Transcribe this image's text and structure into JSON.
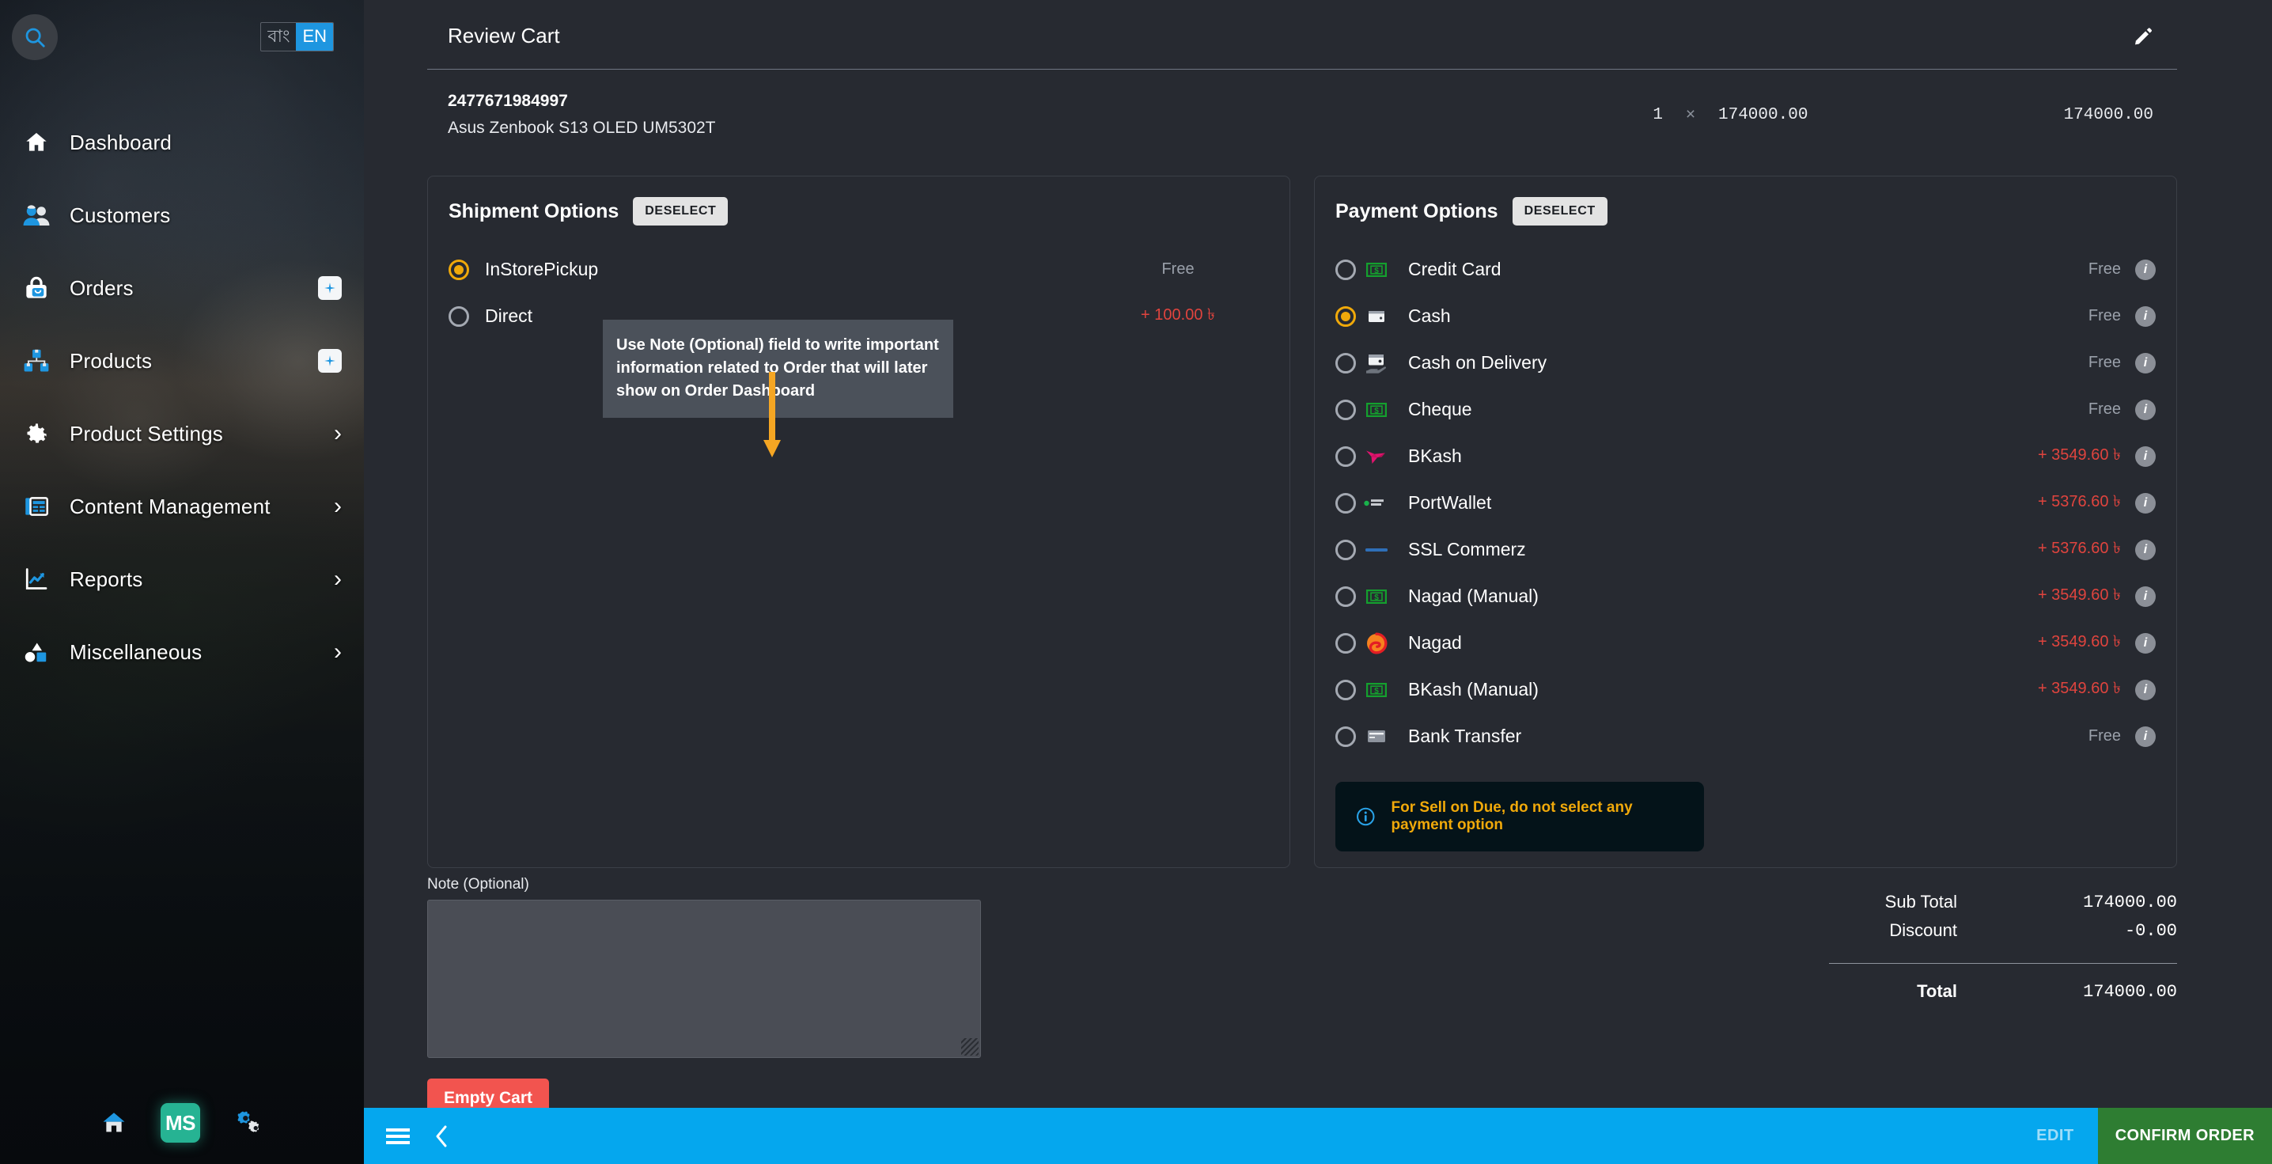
{
  "sidebar": {
    "search_icon": "search-icon",
    "language": {
      "options": [
        {
          "label": "বাং",
          "active": false
        },
        {
          "label": "EN",
          "active": true
        }
      ]
    },
    "items": [
      {
        "label": "Dashboard",
        "icon": "home-icon",
        "badge": null,
        "chevron": false
      },
      {
        "label": "Customers",
        "icon": "customers-icon",
        "badge": null,
        "chevron": false
      },
      {
        "label": "Orders",
        "icon": "orders-bag-icon",
        "badge": "+",
        "chevron": false
      },
      {
        "label": "Products",
        "icon": "products-icon",
        "badge": "+",
        "chevron": false
      },
      {
        "label": "Product Settings",
        "icon": "gear-icon",
        "badge": null,
        "chevron": true
      },
      {
        "label": "Content Management",
        "icon": "content-icon",
        "badge": null,
        "chevron": true
      },
      {
        "label": "Reports",
        "icon": "chart-line-icon",
        "badge": null,
        "chevron": true
      },
      {
        "label": "Miscellaneous",
        "icon": "shapes-icon",
        "badge": null,
        "chevron": true
      }
    ],
    "bottom": {
      "home_icon": "home-icon",
      "logo_text": "MS",
      "settings_icon": "gears-icon"
    }
  },
  "cart": {
    "title": "Review Cart",
    "edit_icon": "pencil-icon",
    "item": {
      "sku": "2477671984997",
      "name": "Asus Zenbook S13 OLED UM5302T",
      "qty": "1",
      "times": "×",
      "unit_price": "174000.00",
      "line_total": "174000.00"
    }
  },
  "shipment": {
    "title": "Shipment Options",
    "deselect_label": "DESELECT",
    "options": [
      {
        "label": "InStorePickup",
        "price": "Free",
        "selected": true,
        "fee": false
      },
      {
        "label": "Direct",
        "price": "+ 100.00 ৳",
        "selected": false,
        "fee": true
      }
    ]
  },
  "payment": {
    "title": "Payment Options",
    "deselect_label": "DESELECT",
    "options": [
      {
        "label": "Credit Card",
        "price": "Free",
        "selected": false,
        "fee": false,
        "icon": "banknote-icon"
      },
      {
        "label": "Cash",
        "price": "Free",
        "selected": true,
        "fee": false,
        "icon": "card-icon"
      },
      {
        "label": "Cash on Delivery",
        "price": "Free",
        "selected": false,
        "fee": false,
        "icon": "wallet-hand-icon"
      },
      {
        "label": "Cheque",
        "price": "Free",
        "selected": false,
        "fee": false,
        "icon": "banknote-icon"
      },
      {
        "label": "BKash",
        "price": "+ 3549.60 ৳",
        "selected": false,
        "fee": true,
        "icon": "bkash-icon"
      },
      {
        "label": "PortWallet",
        "price": "+ 5376.60 ৳",
        "selected": false,
        "fee": true,
        "icon": "portwallet-icon"
      },
      {
        "label": "SSL Commerz",
        "price": "+ 5376.60 ৳",
        "selected": false,
        "fee": true,
        "icon": "sslcommerz-icon"
      },
      {
        "label": "Nagad (Manual)",
        "price": "+ 3549.60 ৳",
        "selected": false,
        "fee": true,
        "icon": "banknote-icon"
      },
      {
        "label": "Nagad",
        "price": "+ 3549.60 ৳",
        "selected": false,
        "fee": true,
        "icon": "nagad-icon"
      },
      {
        "label": "BKash (Manual)",
        "price": "+ 3549.60 ৳",
        "selected": false,
        "fee": true,
        "icon": "banknote-icon"
      },
      {
        "label": "Bank Transfer",
        "price": "Free",
        "selected": false,
        "fee": false,
        "icon": "card-icon"
      }
    ],
    "due_banner": {
      "icon": "info-circle-icon",
      "text": "For Sell on Due, do not select any payment option"
    }
  },
  "note": {
    "label": "Note (Optional)",
    "value": "",
    "placeholder": ""
  },
  "actions": {
    "empty_cart_label": "Empty Cart"
  },
  "totals": {
    "sub_total_label": "Sub Total",
    "sub_total_value": "174000.00",
    "discount_label": "Discount",
    "discount_value": "-0.00",
    "total_label": "Total",
    "total_value": "174000.00"
  },
  "tooltip": {
    "text": "Use Note (Optional) field to write important information related to Order that will later show on Order Dashboard",
    "arrow_color": "#f5a623"
  },
  "bottombar": {
    "menu_icon": "hamburger-menu-icon",
    "back_icon": "chevron-left-icon",
    "edit_label": "EDIT",
    "confirm_label": "CONFIRM ORDER"
  },
  "colors": {
    "accent_blue": "#05a7ee",
    "confirm_green": "#2e7d32",
    "selected_amber": "#f0a90a",
    "fee_red": "#e0443e",
    "danger_red": "#f2544f",
    "logo_teal": "#26b393"
  }
}
